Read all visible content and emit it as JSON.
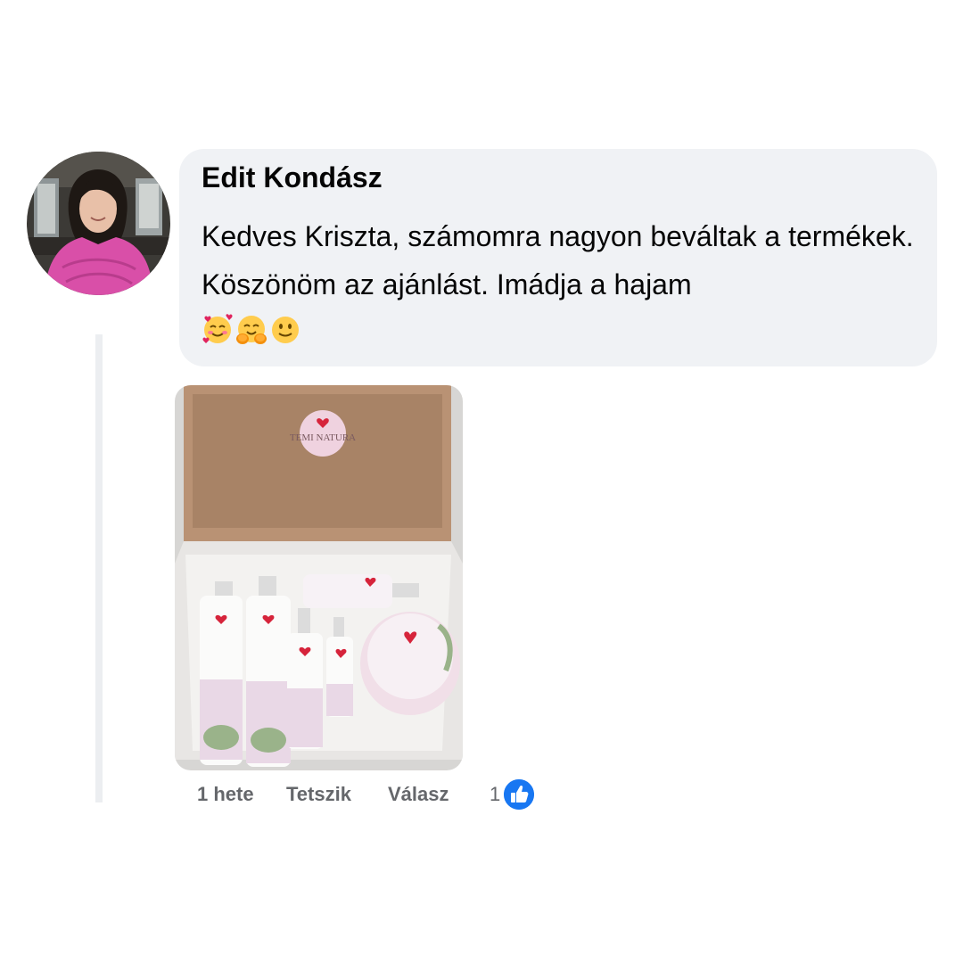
{
  "comment": {
    "author": "Edit Kondász",
    "text": "Kedves Kriszta, számomra nagyon beváltak a termékek. Köszönöm az ajánlást. Imádja a hajam",
    "emojis": [
      "smiling-face-with-hearts-icon",
      "hugging-face-icon",
      "slightly-smiling-face-icon"
    ],
    "attachment_brand": "TEMI NATURA"
  },
  "actions": {
    "time": "1 hete",
    "like_label": "Tetszik",
    "reply_label": "Válasz",
    "reaction_count": "1",
    "reaction_icon": "like-thumb-icon"
  },
  "colors": {
    "bubble": "#f0f2f5",
    "like_blue": "#1877f2",
    "meta_text": "#65676b",
    "sweater_pink": "#d94fa8"
  }
}
